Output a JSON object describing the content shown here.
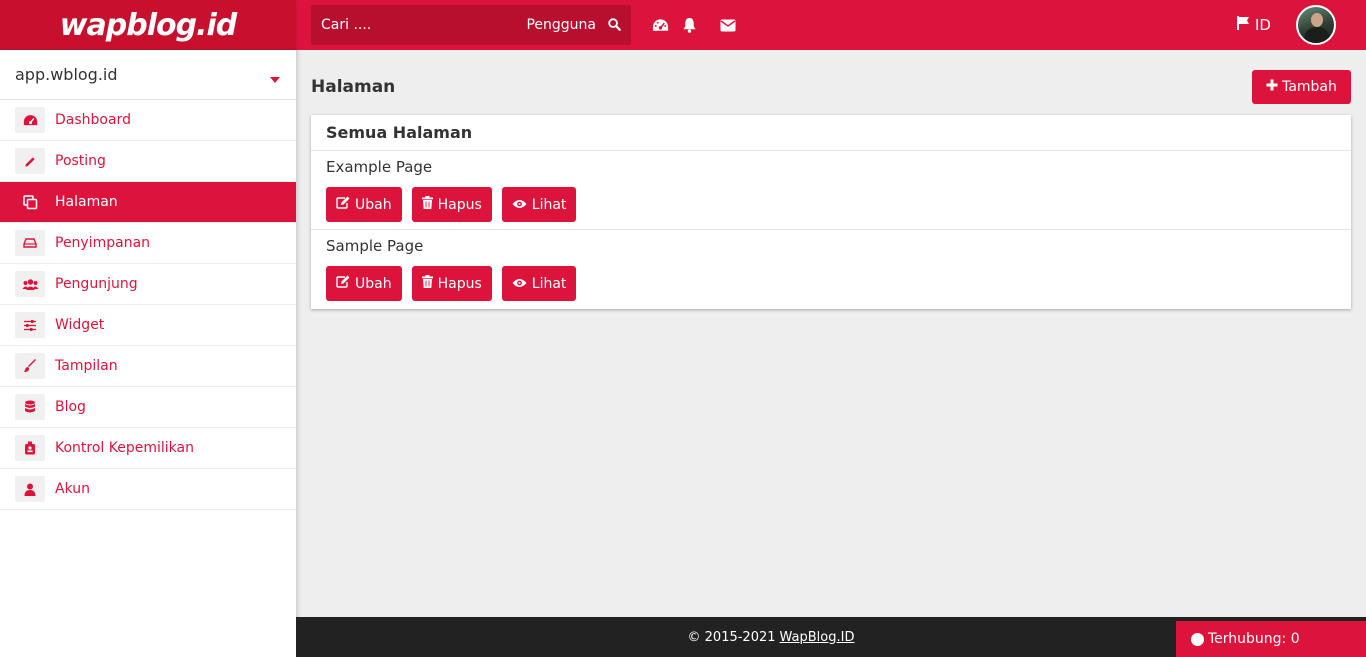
{
  "header": {
    "logo_text": "wapblog.id",
    "search_placeholder": "Cari ....",
    "search_scope": "Pengguna",
    "language": "ID",
    "icons": [
      "dashboard-icon",
      "bell-icon",
      "envelope-icon",
      "flag-icon",
      "search-icon"
    ]
  },
  "sidebar": {
    "site": "app.wblog.id",
    "items": [
      {
        "label": "Dashboard",
        "icon": "dashboard-icon"
      },
      {
        "label": "Posting",
        "icon": "pencil-icon"
      },
      {
        "label": "Halaman",
        "icon": "pages-icon",
        "active": true
      },
      {
        "label": "Penyimpanan",
        "icon": "drive-icon"
      },
      {
        "label": "Pengunjung",
        "icon": "users-icon"
      },
      {
        "label": "Widget",
        "icon": "sliders-icon"
      },
      {
        "label": "Tampilan",
        "icon": "brush-icon"
      },
      {
        "label": "Blog",
        "icon": "database-icon"
      },
      {
        "label": "Kontrol Kepemilikan",
        "icon": "badge-icon"
      },
      {
        "label": "Akun",
        "icon": "user-icon"
      }
    ]
  },
  "main": {
    "title": "Halaman",
    "add_label": "Tambah",
    "card_title": "Semua Halaman",
    "pages": [
      {
        "name": "Example Page"
      },
      {
        "name": "Sample Page"
      }
    ],
    "actions": {
      "edit": "Ubah",
      "delete": "Hapus",
      "view": "Lihat"
    }
  },
  "footer": {
    "copyright": "© 2015-2021",
    "link": "WapBlog.ID",
    "connected": "Terhubung: 0"
  },
  "colors": {
    "accent": "#dc143c",
    "footer": "#222222",
    "background": "#eeeeee"
  }
}
